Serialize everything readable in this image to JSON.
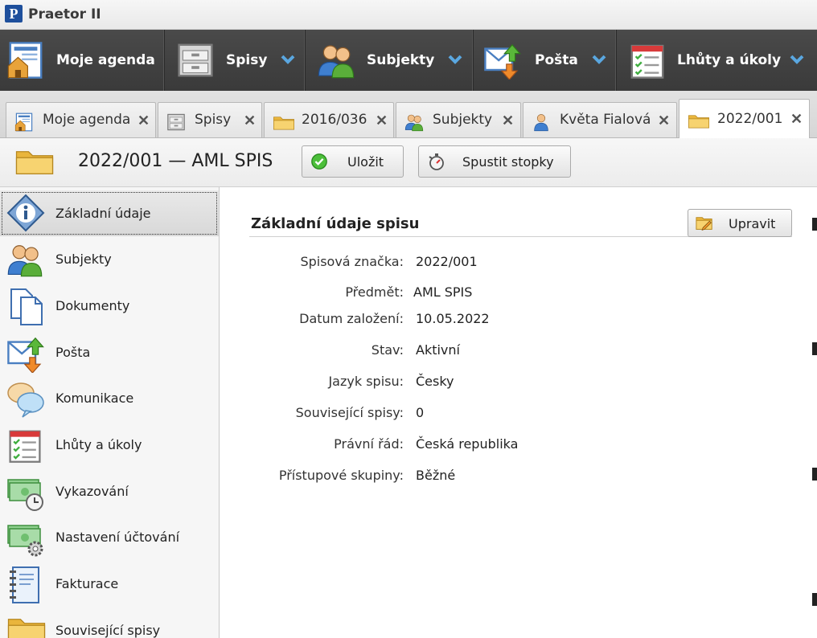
{
  "app": {
    "logo_letter": "P",
    "title": "Praetor II"
  },
  "main_menu": [
    {
      "label": "Moje agenda",
      "icon": "home-agenda-icon"
    },
    {
      "label": "Spisy",
      "icon": "file-cabinet-icon"
    },
    {
      "label": "Subjekty",
      "icon": "people-icon"
    },
    {
      "label": "Pošta",
      "icon": "mail-icon"
    },
    {
      "label": "Lhůty a úkoly",
      "icon": "calendar-checklist-icon"
    }
  ],
  "tabs": [
    {
      "label": "Moje agenda",
      "icon": "home-agenda-icon",
      "active": false
    },
    {
      "label": "Spisy",
      "icon": "file-cabinet-icon",
      "active": false
    },
    {
      "label": "2016/036",
      "icon": "folder-icon",
      "active": false
    },
    {
      "label": "Subjekty",
      "icon": "people-icon",
      "active": false
    },
    {
      "label": "Květa Fialová",
      "icon": "person-icon",
      "active": false
    },
    {
      "label": "2022/001",
      "icon": "folder-icon",
      "active": true
    }
  ],
  "header": {
    "title": "2022/001 — AML SPIS",
    "save_label": "Uložit",
    "stopwatch_label": "Spustit stopky"
  },
  "sidebar": [
    {
      "label": "Základní údaje",
      "icon": "info-icon",
      "active": true
    },
    {
      "label": "Subjekty",
      "icon": "people-icon"
    },
    {
      "label": "Dokumenty",
      "icon": "documents-icon"
    },
    {
      "label": "Pošta",
      "icon": "mail-icon"
    },
    {
      "label": "Komunikace",
      "icon": "chat-bubbles-icon"
    },
    {
      "label": "Lhůty a úkoly",
      "icon": "calendar-checklist-icon"
    },
    {
      "label": "Vykazování",
      "icon": "money-clock-icon"
    },
    {
      "label": "Nastavení účtování",
      "icon": "money-gear-icon"
    },
    {
      "label": "Fakturace",
      "icon": "invoice-notebook-icon"
    },
    {
      "label": "Související spisy",
      "icon": "folder-icon"
    }
  ],
  "section": {
    "title": "Základní údaje spisu",
    "edit_label": "Upravit",
    "rows": [
      {
        "label": "Spisová značka:",
        "value": "2022/001"
      },
      {
        "label": "Předmět:",
        "value": "AML SPIS"
      },
      {
        "label": "Datum založení:",
        "value": "10.05.2022"
      },
      {
        "label": "Stav:",
        "value": "Aktivní"
      },
      {
        "label": "Jazyk spisu:",
        "value": "Česky"
      },
      {
        "label": "Související spisy:",
        "value": "0"
      },
      {
        "label": "Právní řád:",
        "value": "Česká republika"
      },
      {
        "label": "Přístupové skupiny:",
        "value": "Běžné"
      }
    ]
  },
  "colors": {
    "menu_bg": "#3f3f3f",
    "chevron": "#5aa7e0",
    "accent_green": "#3fae3f",
    "folder": "#f2c24f"
  }
}
